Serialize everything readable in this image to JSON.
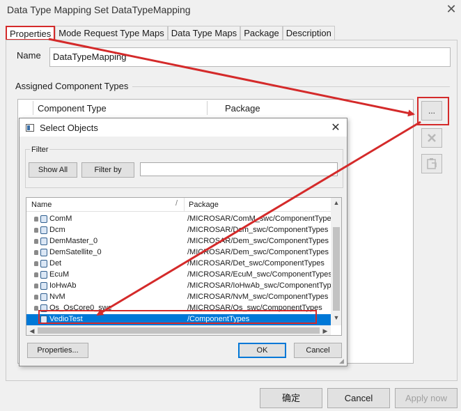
{
  "window": {
    "title": "Data Type Mapping Set DataTypeMapping",
    "close_glyph": "✕"
  },
  "tabs": [
    "Properties",
    "Mode Request Type Maps",
    "Data Type Maps",
    "Package",
    "Description"
  ],
  "name_field": {
    "label": "Name",
    "value": "DataTypeMapping"
  },
  "assigned": {
    "group_label": "Assigned Component Types",
    "columns": [
      "Component Type",
      "Package"
    ],
    "add_button": "...",
    "remove_icon": "x-icon",
    "edit_icon": "clipboard-icon"
  },
  "footer": {
    "ok": "确定",
    "cancel": "Cancel",
    "apply": "Apply now"
  },
  "dialog": {
    "title": "Select Objects",
    "close_glyph": "✕",
    "filter_label": "Filter",
    "show_all": "Show All",
    "filter_by": "Filter by",
    "filter_value": "",
    "columns": [
      "Name",
      "Package"
    ],
    "sort_glyph": "/",
    "rows": [
      {
        "name": "ComM",
        "package": "/MICROSAR/ComM_swc/ComponentTypes",
        "locked": true,
        "selected": false
      },
      {
        "name": "Dcm",
        "package": "/MICROSAR/Dcm_swc/ComponentTypes",
        "locked": true,
        "selected": false
      },
      {
        "name": "DemMaster_0",
        "package": "/MICROSAR/Dem_swc/ComponentTypes",
        "locked": true,
        "selected": false
      },
      {
        "name": "DemSatellite_0",
        "package": "/MICROSAR/Dem_swc/ComponentTypes",
        "locked": true,
        "selected": false
      },
      {
        "name": "Det",
        "package": "/MICROSAR/Det_swc/ComponentTypes",
        "locked": true,
        "selected": false
      },
      {
        "name": "EcuM",
        "package": "/MICROSAR/EcuM_swc/ComponentTypes",
        "locked": true,
        "selected": false
      },
      {
        "name": "IoHwAb",
        "package": "/MICROSAR/IoHwAb_swc/ComponentTypes",
        "locked": true,
        "selected": false
      },
      {
        "name": "NvM",
        "package": "/MICROSAR/NvM_swc/ComponentTypes",
        "locked": true,
        "selected": false
      },
      {
        "name": "Os_OsCore0_swc",
        "package": "/MICROSAR/Os_swc/ComponentTypes",
        "locked": true,
        "selected": false
      },
      {
        "name": "VedioTest",
        "package": "/ComponentTypes",
        "locked": false,
        "selected": true
      }
    ],
    "properties_button": "Properties...",
    "ok": "OK",
    "cancel": "Cancel"
  },
  "colors": {
    "annotation": "#d42a2a",
    "selection": "#0078d7"
  }
}
